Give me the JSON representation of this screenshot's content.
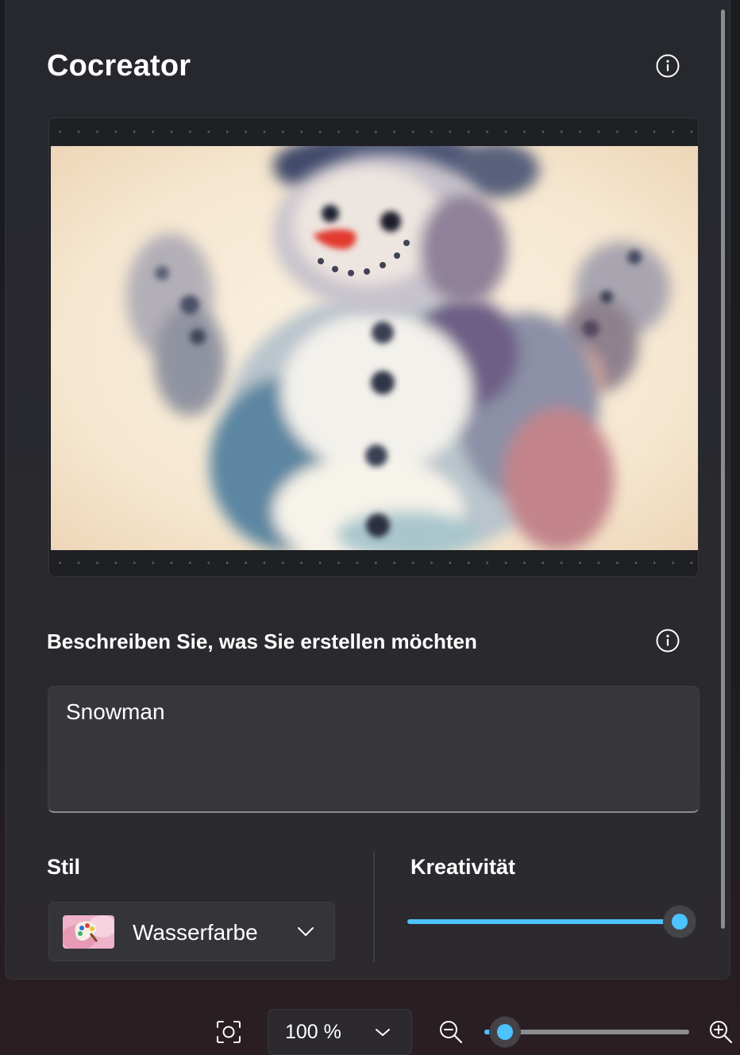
{
  "panel": {
    "title": "Cocreator",
    "prompt_label": "Beschreiben Sie, was Sie erstellen möchten",
    "prompt_value": "Snowman",
    "style_label": "Stil",
    "style_value": "Wasserfarbe",
    "creativity_label": "Kreativität",
    "creativity_level": 1.0,
    "generated_image": "watercolor snowman"
  },
  "bottom_bar": {
    "zoom_value": "100 %",
    "zoom_slider_level": 0.08
  },
  "colors": {
    "accent": "#4cc2ff",
    "panel_bg": "#27282d"
  },
  "icons": [
    "info-icon",
    "info-icon",
    "chevron-down-icon",
    "screenshot-fit-icon",
    "zoom-out-icon",
    "zoom-in-icon"
  ]
}
